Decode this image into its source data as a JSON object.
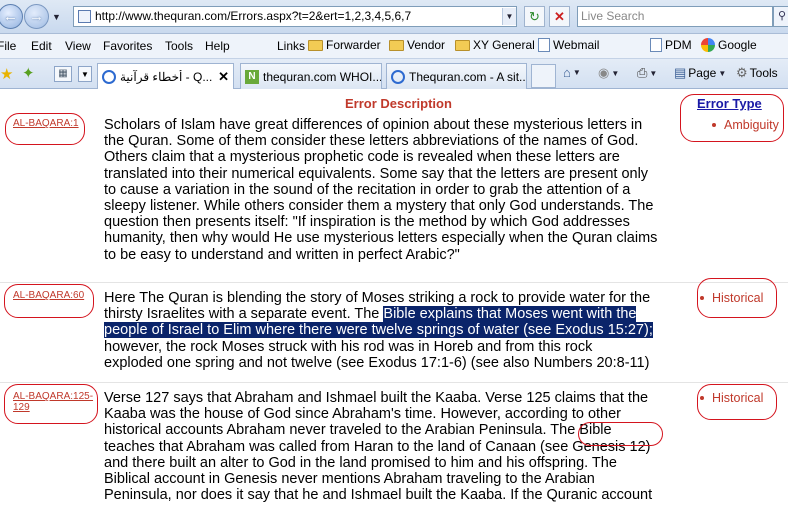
{
  "browser": {
    "url": "http://www.thequran.com/Errors.aspx?t=2&ert=1,2,3,4,5,6,7",
    "search_placeholder": "Live Search",
    "menu": [
      "File",
      "Edit",
      "View",
      "Favorites",
      "Tools",
      "Help"
    ],
    "links_label": "Links",
    "links": [
      "Forwarder",
      "Vendor",
      "XY General",
      "Webmail",
      "PDM",
      "Google"
    ],
    "tabs": [
      {
        "title": "أخطاء قرآنية - Q...",
        "active": true
      },
      {
        "title": "thequran.com WHOI..."
      },
      {
        "title": "Thequran.com - A sit..."
      }
    ],
    "commands": {
      "page": "Page",
      "tools": "Tools"
    }
  },
  "page": {
    "header_description": "Error Description",
    "header_type": "Error Type",
    "errors": [
      {
        "ref": "AL-BAQARA:1",
        "type": "Ambiguity",
        "lines": [
          "Scholars of Islam have great differences of opinion about these mysterious letters in",
          "the Quran. Some of them consider these letters abbreviations of the names of God.",
          "Others claim that a mysterious prophetic code is revealed when these letters are",
          "translated into their numerical equivalents. Some say that the letters are present only",
          "to cause a variation in the sound of the recitation in order to grab the attention of a",
          "sleepy listener. While others consider them a mystery that only God understands. The",
          "question then presents itself: \"If inspiration is the method by which God addresses",
          "humanity, then why would He use mysterious letters especially when the Quran claims",
          "to be easy to understand and written in perfect Arabic?\""
        ]
      },
      {
        "ref": "AL-BAQARA:60",
        "type": "Historical",
        "line1_pre": "Here The Quran is blending the story of Moses striking a rock to provide water for the",
        "line2_pre": "thirsty Israelites with a separate event. The ",
        "line2_hl": "Bible explains that Moses went with the",
        "line3_hl": "people of Israel to Elim where there were twelve springs of water (see Exodus 15:27);",
        "line4": "however, the rock Moses struck with his rod was in Horeb and from this rock",
        "line5": "exploded one spring and not twelve (see Exodus 17:1-6) (see also Numbers 20:8-11)"
      },
      {
        "ref_line1": "AL-BAQARA:125-",
        "ref_line2": "129",
        "type": "Historical",
        "line1": "Verse 127 says that Abraham and Ishmael built the Kaaba. Verse 125 claims that the",
        "line2": "Kaaba was the house of God since Abraham's time. However, according to other",
        "line3_pre": "historical accounts Abraham never traveled to the Arabian Peninsula. ",
        "line3_mark": "The Bible",
        "line4": "teaches that Abraham was called from Haran to the land of Canaan (see Genesis 12)",
        "line5": "and there built an alter to God in the land promised to him and his offspring. The",
        "line6": "Biblical account in Genesis never mentions Abraham traveling to the Arabian",
        "line7": "Peninsula, nor does it say that he and Ishmael built the Kaaba. If the Quranic account"
      }
    ]
  }
}
